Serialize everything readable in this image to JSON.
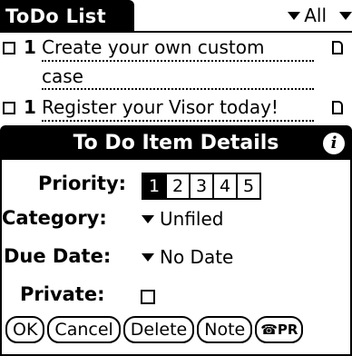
{
  "header": {
    "title": "ToDo List",
    "category_filter": "All"
  },
  "todos": [
    {
      "priority": "1",
      "desc_line1": "Create your own custom",
      "desc_line2": "case"
    },
    {
      "priority": "1",
      "desc_line1": "Register your Visor today!"
    }
  ],
  "dialog": {
    "title": "To Do Item Details",
    "priority_label": "Priority:",
    "priorities": [
      "1",
      "2",
      "3",
      "4",
      "5"
    ],
    "selected_priority": "1",
    "category_label": "Category:",
    "category_value": "Unfiled",
    "due_label": "Due Date:",
    "due_value": "No Date",
    "private_label": "Private:",
    "buttons": {
      "ok": "OK",
      "cancel": "Cancel",
      "delete": "Delete",
      "note": "Note",
      "beam": "PR"
    }
  }
}
